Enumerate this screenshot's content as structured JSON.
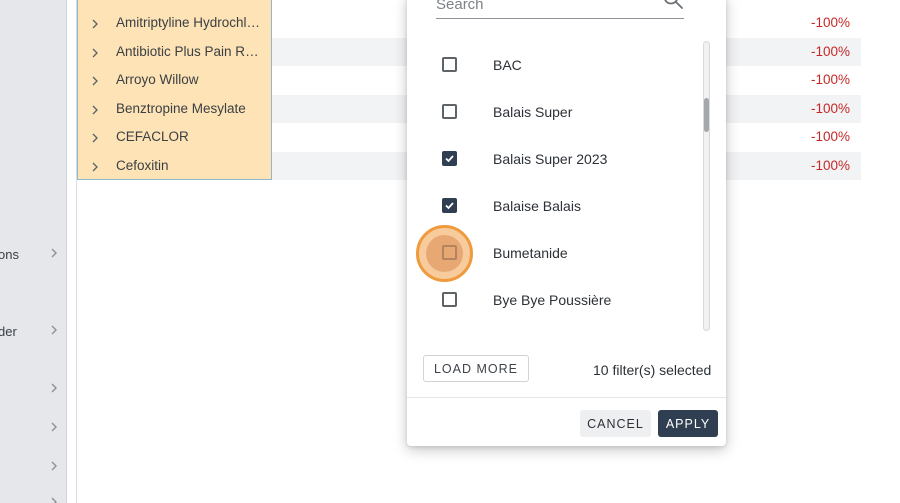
{
  "sidebar": {
    "items": [
      {
        "label": "ons"
      },
      {
        "label": "der"
      },
      {
        "label": ""
      },
      {
        "label": ""
      },
      {
        "label": ""
      }
    ]
  },
  "table": {
    "rows": [
      {
        "name": "Amitriptyline Hydrochlo…",
        "change": "-100%"
      },
      {
        "name": "Antibiotic Plus Pain Re…",
        "change": "-100%"
      },
      {
        "name": "Arroyo Willow",
        "change": "-100%"
      },
      {
        "name": "Benztropine Mesylate",
        "change": "-100%"
      },
      {
        "name": "CEFACLOR",
        "change": "-100%"
      },
      {
        "name": "Cefoxitin",
        "change": "-100%"
      }
    ]
  },
  "filter_dialog": {
    "search_placeholder": "Search",
    "options": [
      {
        "label": "BAC",
        "checked": false
      },
      {
        "label": "Balais Super",
        "checked": false
      },
      {
        "label": "Balais Super 2023",
        "checked": true
      },
      {
        "label": "Balaise Balais",
        "checked": true
      },
      {
        "label": "Bumetanide",
        "checked": false
      },
      {
        "label": "Bye Bye Poussière",
        "checked": false
      }
    ],
    "load_more_label": "LOAD MORE",
    "selected_count": "10 filter(s) selected",
    "cancel_label": "CANCEL",
    "apply_label": "APPLY"
  },
  "colors": {
    "accent": "#2f3e50",
    "highlight_cell": "#fde3b5",
    "negative": "#c62828",
    "focus": "#f09a3e"
  }
}
